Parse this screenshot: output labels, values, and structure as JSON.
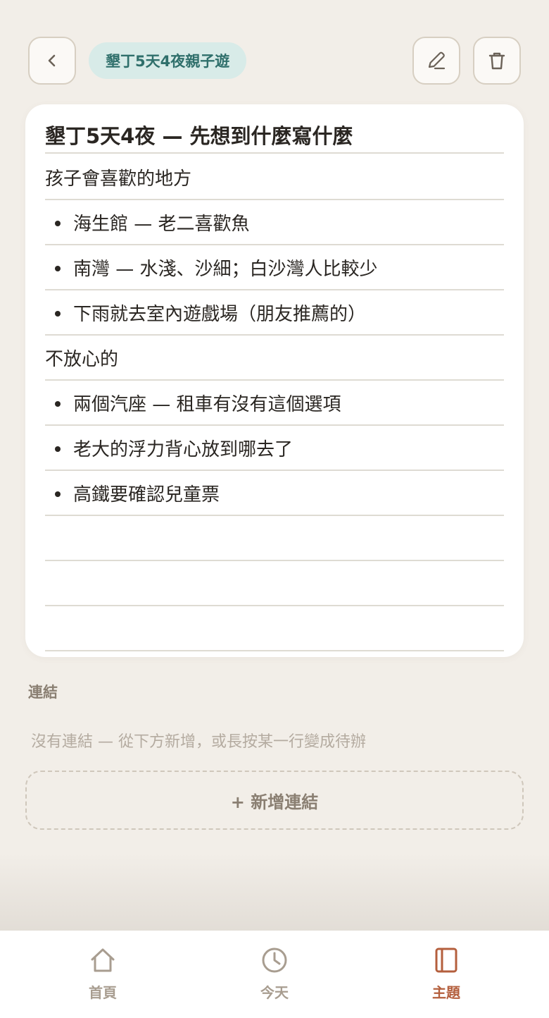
{
  "header": {
    "topic": "墾丁5天4夜親子遊"
  },
  "note": {
    "title": "墾丁5天4夜 — 先想到什麼寫什麼",
    "lines": [
      "孩子會喜歡的地方",
      "海生館 — 老二喜歡魚",
      "南灣 — 水淺、沙細；白沙灣人比較少",
      "下雨就去室內遊戲場（朋友推薦的）",
      "不放心的",
      "兩個汽座 — 租車有沒有這個選項",
      "老大的浮力背心放到哪去了",
      "高鐵要確認兒童票",
      "",
      "",
      ""
    ]
  },
  "links": {
    "label": "連結",
    "empty_text": "沒有連結 — 從下方新增，或長按某一行變成待辦",
    "add_label": "+ 新增連結"
  },
  "nav": {
    "home": "首頁",
    "today": "今天",
    "topics": "主題"
  },
  "colors": {
    "background": "#f2eee8",
    "accent": "#b45f3d",
    "pill_bg": "#d8ebe8",
    "pill_text": "#2f6f6b"
  }
}
